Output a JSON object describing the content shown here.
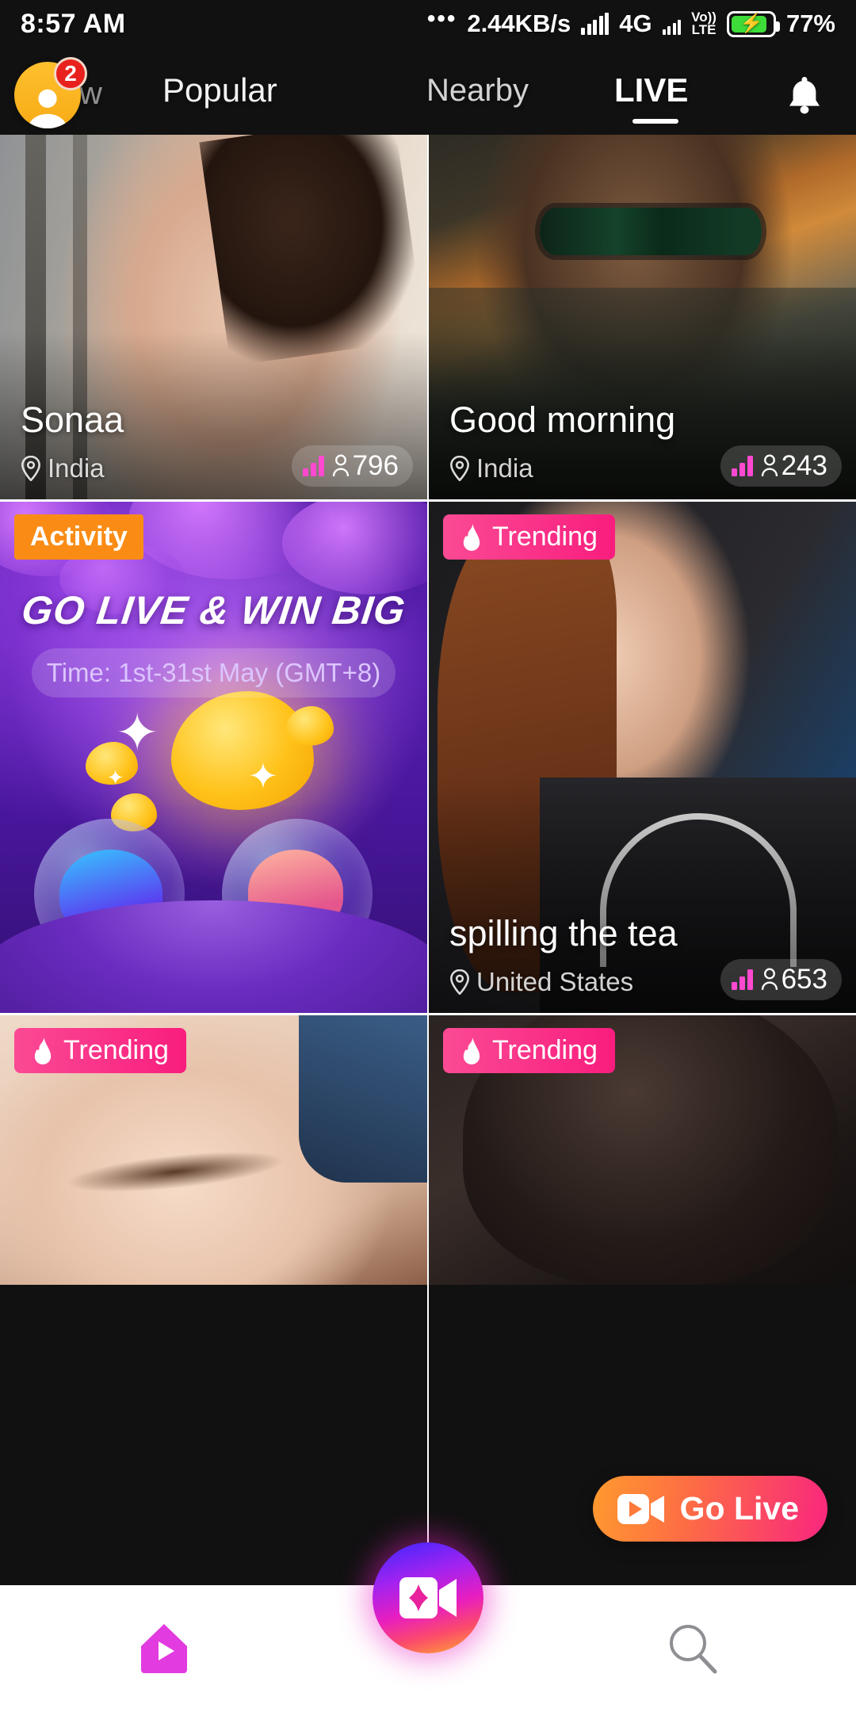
{
  "status_bar": {
    "time": "8:57 AM",
    "overflow_dots": "•••",
    "network_speed": "2.44KB/s",
    "network_type": "4G",
    "volte_top": "Vo))",
    "volte_bottom": "LTE",
    "battery_percent": "77%",
    "battery_charging": true
  },
  "top_nav": {
    "avatar_badge": "2",
    "tabs": [
      {
        "label": "w",
        "name": "tab-follow-clipped",
        "active": false
      },
      {
        "label": "Popular",
        "name": "tab-popular",
        "active": false
      },
      {
        "label": "Nearby",
        "name": "tab-nearby",
        "active": false
      },
      {
        "label": "LIVE",
        "name": "tab-live",
        "active": true
      }
    ],
    "bell_icon": "bell-icon",
    "avatar_icon": "person-avatar-icon"
  },
  "cards": [
    {
      "name": "Sonaa",
      "location": "India",
      "viewers": "796",
      "tag": null
    },
    {
      "name": "Good morning",
      "location": "India",
      "viewers": "243",
      "tag": null
    },
    {
      "name": "",
      "location": "",
      "viewers": "",
      "tag": "Activity",
      "promo_title": "GO LIVE & WIN BIG",
      "promo_time": "Time: 1st-31st May (GMT+8)"
    },
    {
      "name": "spilling the tea",
      "location": "United States",
      "viewers": "653",
      "tag": "Trending"
    },
    {
      "name": "",
      "location": "",
      "viewers": "",
      "tag": "Trending"
    },
    {
      "name": "",
      "location": "",
      "viewers": "",
      "tag": "Trending"
    }
  ],
  "go_live": {
    "label": "Go Live",
    "icon": "video-camera-icon"
  },
  "bottom_nav": {
    "home_icon": "home-play-icon",
    "center_icon": "live-video-sparkle-icon",
    "search_icon": "search-icon"
  },
  "colors": {
    "trending_badge": "#f9217c",
    "activity_badge": "#fa8c16",
    "accent_pink": "#ff49d0",
    "go_live_from": "#ff9a2e",
    "go_live_to": "#f9267f",
    "avatar_yellow": "#ffc02e",
    "badge_red": "#e8211d",
    "battery_green": "#3ddc39"
  }
}
